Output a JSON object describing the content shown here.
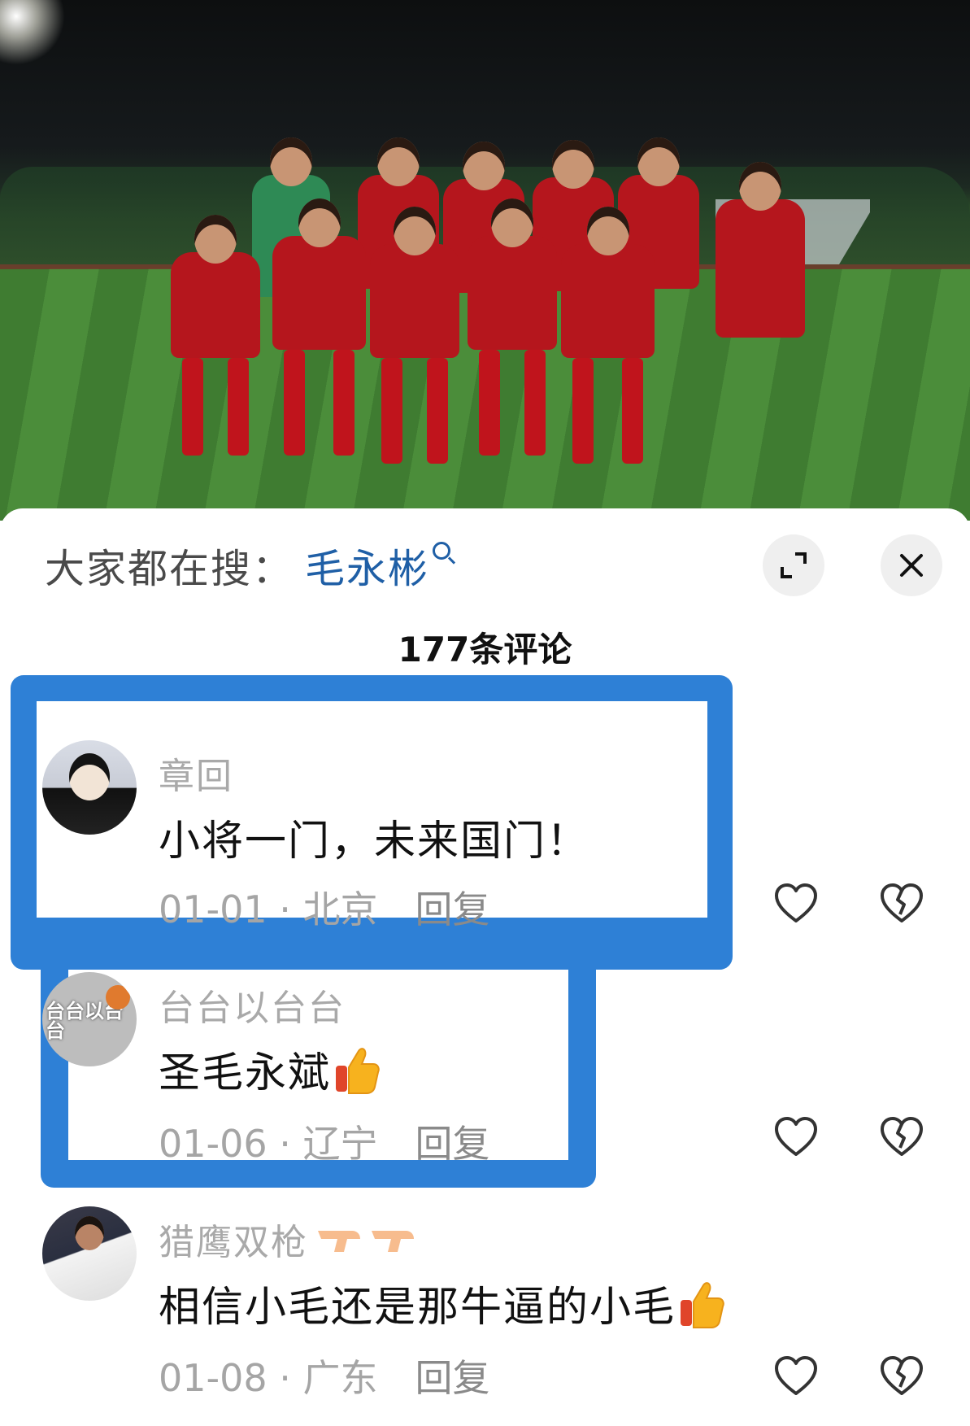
{
  "header": {
    "search_label": "大家都在搜：",
    "search_term": "毛永彬",
    "comment_count": "177条评论"
  },
  "icons": {
    "search": "search-icon",
    "expand": "expand-icon",
    "close": "close-icon",
    "like": "heart-icon",
    "dislike": "broken-heart-icon",
    "thumbs_up": "thumbs-up-emoji",
    "water_gun": "water-gun-emoji"
  },
  "colors": {
    "accent": "#1f5fa6",
    "highlight": "#2e80d6"
  },
  "comments": [
    {
      "username": "章回",
      "text": "小将一门，未来国门！",
      "date": "01-01",
      "location": "北京",
      "meta": "01-01 · 北京",
      "reply": "回复"
    },
    {
      "username": "台台以台台",
      "avatar_text": "台台以台台",
      "text": "圣毛永斌",
      "date": "01-06",
      "location": "辽宁",
      "meta": "01-06 · 辽宁",
      "reply": "回复"
    },
    {
      "username": "猎鹰双枪",
      "text": "相信小毛还是那牛逼的小毛",
      "date": "01-08",
      "location": "广东",
      "meta": "01-08 · 广东",
      "reply": "回复"
    }
  ]
}
